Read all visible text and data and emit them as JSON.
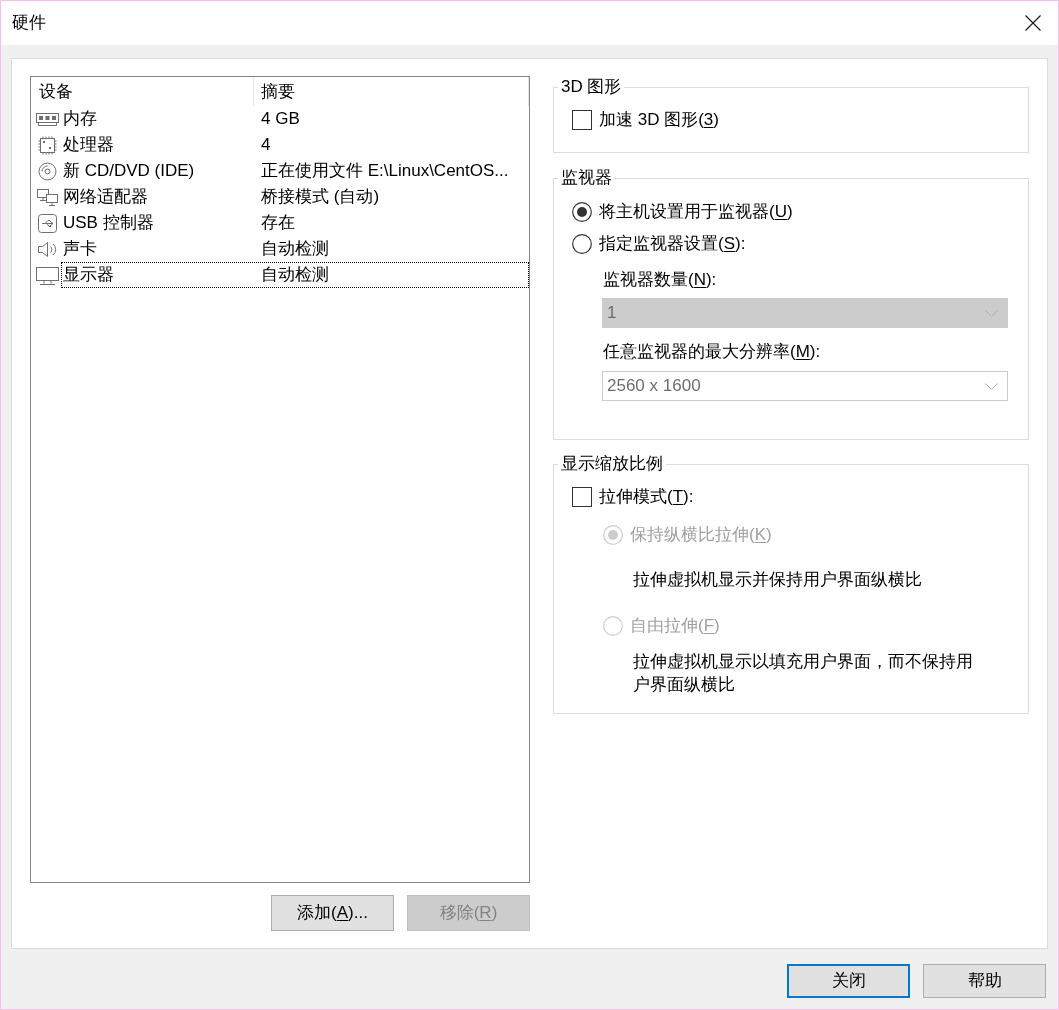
{
  "window": {
    "title": "硬件"
  },
  "device_table": {
    "columns": [
      "设备",
      "摘要"
    ],
    "rows": [
      {
        "kind": "memory",
        "device": "内存",
        "summary": "4 GB",
        "selected": false
      },
      {
        "kind": "processor",
        "device": "处理器",
        "summary": "4",
        "selected": false
      },
      {
        "kind": "cd_dvd",
        "device": "新 CD/DVD (IDE)",
        "summary": "正在使用文件 E:\\Linux\\CentOS...",
        "selected": false
      },
      {
        "kind": "network",
        "device": "网络适配器",
        "summary": "桥接模式 (自动)",
        "selected": false
      },
      {
        "kind": "usb",
        "device": "USB 控制器",
        "summary": "存在",
        "selected": false
      },
      {
        "kind": "sound",
        "device": "声卡",
        "summary": "自动检测",
        "selected": false
      },
      {
        "kind": "display",
        "device": "显示器",
        "summary": "自动检测",
        "selected": true
      }
    ]
  },
  "list_buttons": [
    {
      "label": "添加(A)...",
      "disabled": false
    },
    {
      "label": "移除(R)",
      "disabled": true
    }
  ],
  "graphics_3d": {
    "title": "3D 图形",
    "accelerate": {
      "label": "加速 3D 图形(3)",
      "checked": false
    }
  },
  "monitors": {
    "title": "监视器",
    "modes": [
      {
        "label": "将主机设置用于监视器(U)",
        "selected": true
      },
      {
        "label": "指定监视器设置(S):",
        "selected": false
      }
    ],
    "fields": [
      {
        "kind": "dropdown",
        "label": "监视器数量(N):",
        "value": "1",
        "disabled": true
      },
      {
        "kind": "combo",
        "label": "任意监视器的最大分辨率(M):",
        "value": "2560 x 1600",
        "disabled": true
      }
    ]
  },
  "display_scaling": {
    "title": "显示缩放比例",
    "stretch_mode": {
      "label": "拉伸模式(T):",
      "checked": false
    },
    "options": [
      {
        "label": "保持纵横比拉伸(K)",
        "selected": true,
        "disabled": true,
        "description": "拉伸虚拟机显示并保持用户界面纵横比"
      },
      {
        "label": "自由拉伸(F)",
        "selected": false,
        "disabled": true,
        "description": "拉伸虚拟机显示以填充用户界面，而不保持用户界面纵横比"
      }
    ]
  },
  "dialog_buttons": [
    {
      "label": "关闭",
      "default": true
    },
    {
      "label": "帮助",
      "default": false
    }
  ]
}
